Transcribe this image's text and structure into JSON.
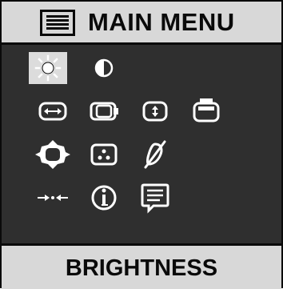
{
  "header": {
    "title": "MAIN MENU",
    "menu_icon": "menu-list-icon"
  },
  "footer": {
    "label": "BRIGHTNESS"
  },
  "colors": {
    "panel": "#2f2f2f",
    "bar": "#d8d8d8",
    "icon": "#ffffff",
    "selected_bg": "#dcdcdc"
  },
  "menu": {
    "selected": "brightness",
    "rows": [
      [
        "brightness-icon",
        "contrast-icon"
      ],
      [
        "horizontal-size-icon",
        "horizontal-position-icon",
        "vertical-size-icon",
        "vertical-position-icon"
      ],
      [
        "geometry-icon",
        "rgb-color-icon",
        "degauss-icon"
      ],
      [
        "reset-icon",
        "information-icon",
        "language-icon"
      ]
    ]
  }
}
